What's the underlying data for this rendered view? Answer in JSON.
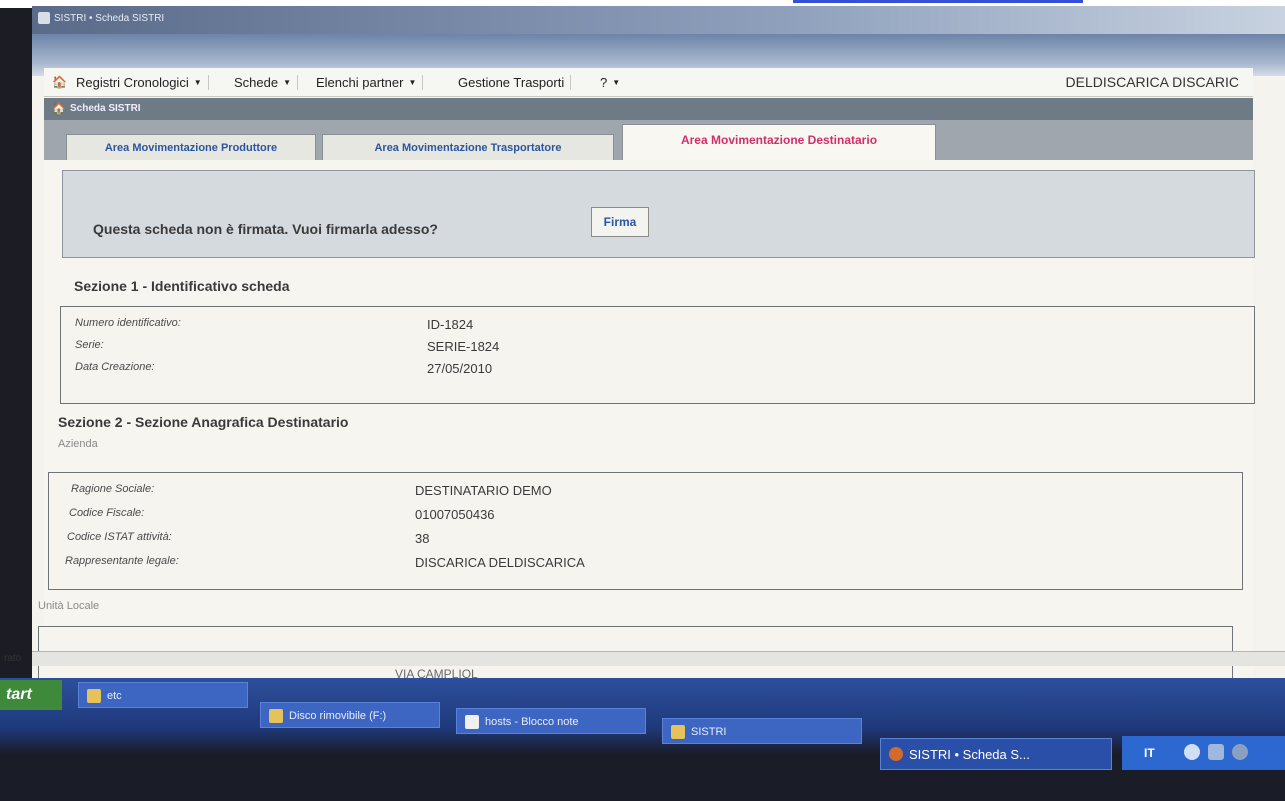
{
  "window": {
    "title": "SISTRI • Scheda SISTRI"
  },
  "menubar": {
    "items": [
      {
        "label": "Registri Cronologici"
      },
      {
        "label": "Schede"
      },
      {
        "label": "Elenchi partner"
      },
      {
        "label": "Gestione Trasporti"
      },
      {
        "label": "?"
      }
    ],
    "user": "DELDISCARICA DISCARIC"
  },
  "breadcrumb": {
    "label": "Scheda SISTRI"
  },
  "tabs": [
    {
      "label": "Area Movimentazione Produttore"
    },
    {
      "label": "Area Movimentazione Trasportatore"
    },
    {
      "label": "Area Movimentazione Destinatario"
    }
  ],
  "sign_prompt": {
    "message": "Questa scheda non è firmata. Vuoi firmarla adesso?",
    "button": "Firma"
  },
  "section1": {
    "title": "Sezione 1 - Identificativo scheda",
    "rows": [
      {
        "label": "Numero identificativo:",
        "value": "ID-1824"
      },
      {
        "label": "Serie:",
        "value": "SERIE-1824"
      },
      {
        "label": "Data Creazione:",
        "value": "27/05/2010"
      }
    ]
  },
  "section2": {
    "title": "Sezione 2 - Sezione Anagrafica Destinatario",
    "azienda_label": "Azienda",
    "rows": [
      {
        "label": "Ragione Sociale:",
        "value": "DESTINATARIO DEMO"
      },
      {
        "label": "Codice Fiscale:",
        "value": "01007050436"
      },
      {
        "label": "Codice ISTAT attività:",
        "value": "38"
      },
      {
        "label": "Rappresentante legale:",
        "value": "DISCARICA DELDISCARICA"
      }
    ],
    "unita_locale_label": "Unità Locale",
    "partial_value": "VIA CAMPLIOL"
  },
  "statusbar": {
    "text": "rato"
  },
  "taskbar": {
    "start": "tart",
    "tasks": [
      {
        "label": "etc"
      },
      {
        "label": "Disco rimovibile (F:)"
      },
      {
        "label": "hosts - Blocco note"
      },
      {
        "label": "SISTRI"
      },
      {
        "label": "SISTRI • Scheda S..."
      }
    ],
    "tray_lang": "IT"
  }
}
